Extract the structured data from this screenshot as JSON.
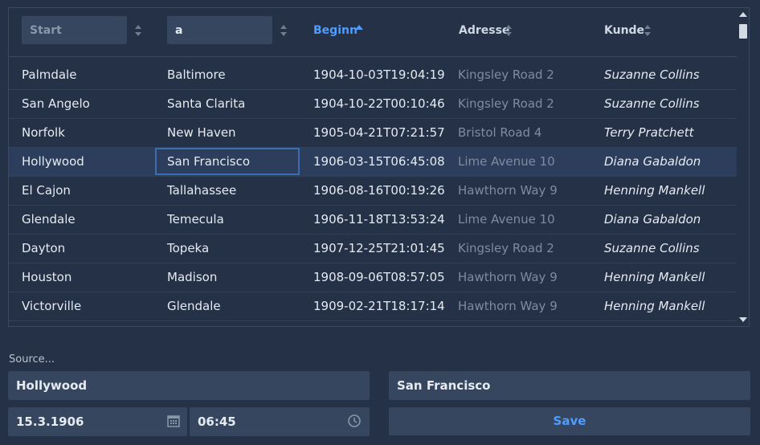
{
  "filters": {
    "start_placeholder": "Start",
    "end_value": "a"
  },
  "headers": {
    "begin": "Beginn",
    "address": "Adresse",
    "customer": "Kunde"
  },
  "rows": [
    {
      "start": "Palmdale",
      "end": "Baltimore",
      "begin": "1904-10-03T19:04:19",
      "address": "Kingsley Road 2",
      "customer": "Suzanne Collins"
    },
    {
      "start": "San Angelo",
      "end": "Santa Clarita",
      "begin": "1904-10-22T00:10:46",
      "address": "Kingsley Road 2",
      "customer": "Suzanne Collins"
    },
    {
      "start": "Norfolk",
      "end": "New Haven",
      "begin": "1905-04-21T07:21:57",
      "address": "Bristol Road 4",
      "customer": "Terry Pratchett"
    },
    {
      "start": "Hollywood",
      "end": "San Francisco",
      "begin": "1906-03-15T06:45:08",
      "address": "Lime Avenue 10",
      "customer": "Diana Gabaldon"
    },
    {
      "start": "El Cajon",
      "end": "Tallahassee",
      "begin": "1906-08-16T00:19:26",
      "address": "Hawthorn Way 9",
      "customer": "Henning Mankell"
    },
    {
      "start": "Glendale",
      "end": "Temecula",
      "begin": "1906-11-18T13:53:24",
      "address": "Lime Avenue 10",
      "customer": "Diana Gabaldon"
    },
    {
      "start": "Dayton",
      "end": "Topeka",
      "begin": "1907-12-25T21:01:45",
      "address": "Kingsley Road 2",
      "customer": "Suzanne Collins"
    },
    {
      "start": "Houston",
      "end": "Madison",
      "begin": "1908-09-06T08:57:05",
      "address": "Hawthorn Way 9",
      "customer": "Henning Mankell"
    },
    {
      "start": "Victorville",
      "end": "Glendale",
      "begin": "1909-02-21T18:17:14",
      "address": "Hawthorn Way 9",
      "customer": "Henning Mankell"
    }
  ],
  "selected_row": 3,
  "form": {
    "source_label": "Source...",
    "start_value": "Hollywood",
    "end_value": "San Francisco",
    "date_value": "15.3.1906",
    "time_value": "06:45",
    "save_label": "Save"
  },
  "colors": {
    "accent": "#4f9dff",
    "background": "#243146",
    "field": "#36465f"
  }
}
